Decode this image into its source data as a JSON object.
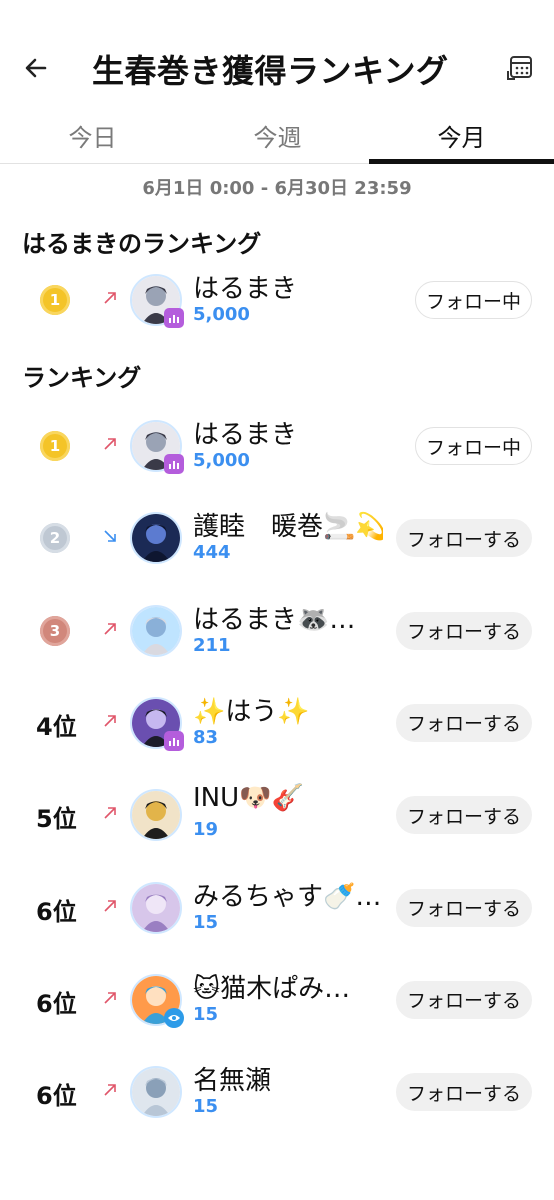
{
  "header": {
    "title": "生春巻き獲得ランキング"
  },
  "tabs": [
    {
      "label": "今日",
      "active": false
    },
    {
      "label": "今週",
      "active": false
    },
    {
      "label": "今月",
      "active": true
    }
  ],
  "period": "6月1日 0:00 - 6月30日 23:59",
  "my_section": {
    "title": "はるまきのランキング",
    "row": {
      "rank": "1",
      "trend": "up",
      "name": "はるまき",
      "score": "5,000",
      "badge": "live",
      "follow": "フォロー中",
      "following": true
    }
  },
  "ranking_section": {
    "title": "ランキング",
    "rows": [
      {
        "rank": "1",
        "trend": "up",
        "name": "はるまき",
        "score": "5,000",
        "badge": "live",
        "follow": "フォロー中",
        "following": true
      },
      {
        "rank": "2",
        "trend": "down",
        "name": "護睦　暖巻🚬💫",
        "score": "444",
        "badge": "",
        "follow": "フォローする",
        "following": false
      },
      {
        "rank": "3",
        "trend": "up",
        "name": "はるまき🦝…",
        "score": "211",
        "badge": "",
        "follow": "フォローする",
        "following": false
      },
      {
        "rank": "4位",
        "trend": "up",
        "name": "✨はう✨",
        "score": "83",
        "badge": "live",
        "follow": "フォローする",
        "following": false
      },
      {
        "rank": "5位",
        "trend": "up",
        "name": "INU🐶🎸",
        "score": "19",
        "badge": "",
        "follow": "フォローする",
        "following": false
      },
      {
        "rank": "6位",
        "trend": "up",
        "name": "みるちゃす🍼…",
        "score": "15",
        "badge": "",
        "follow": "フォローする",
        "following": false
      },
      {
        "rank": "6位",
        "trend": "up",
        "name": "🐱猫木ぱみ…",
        "score": "15",
        "badge": "view",
        "follow": "フォローする",
        "following": false
      },
      {
        "rank": "6位",
        "trend": "up",
        "name": "名無瀬",
        "score": "15",
        "badge": "",
        "follow": "フォローする",
        "following": false
      }
    ]
  },
  "colors": {
    "score": "#3b8ff0",
    "trend_up": "#e0566a",
    "trend_down": "#3b8ff0",
    "gold": "#f4c428",
    "silver": "#bfc8d3",
    "bronze": "#d1877b"
  }
}
